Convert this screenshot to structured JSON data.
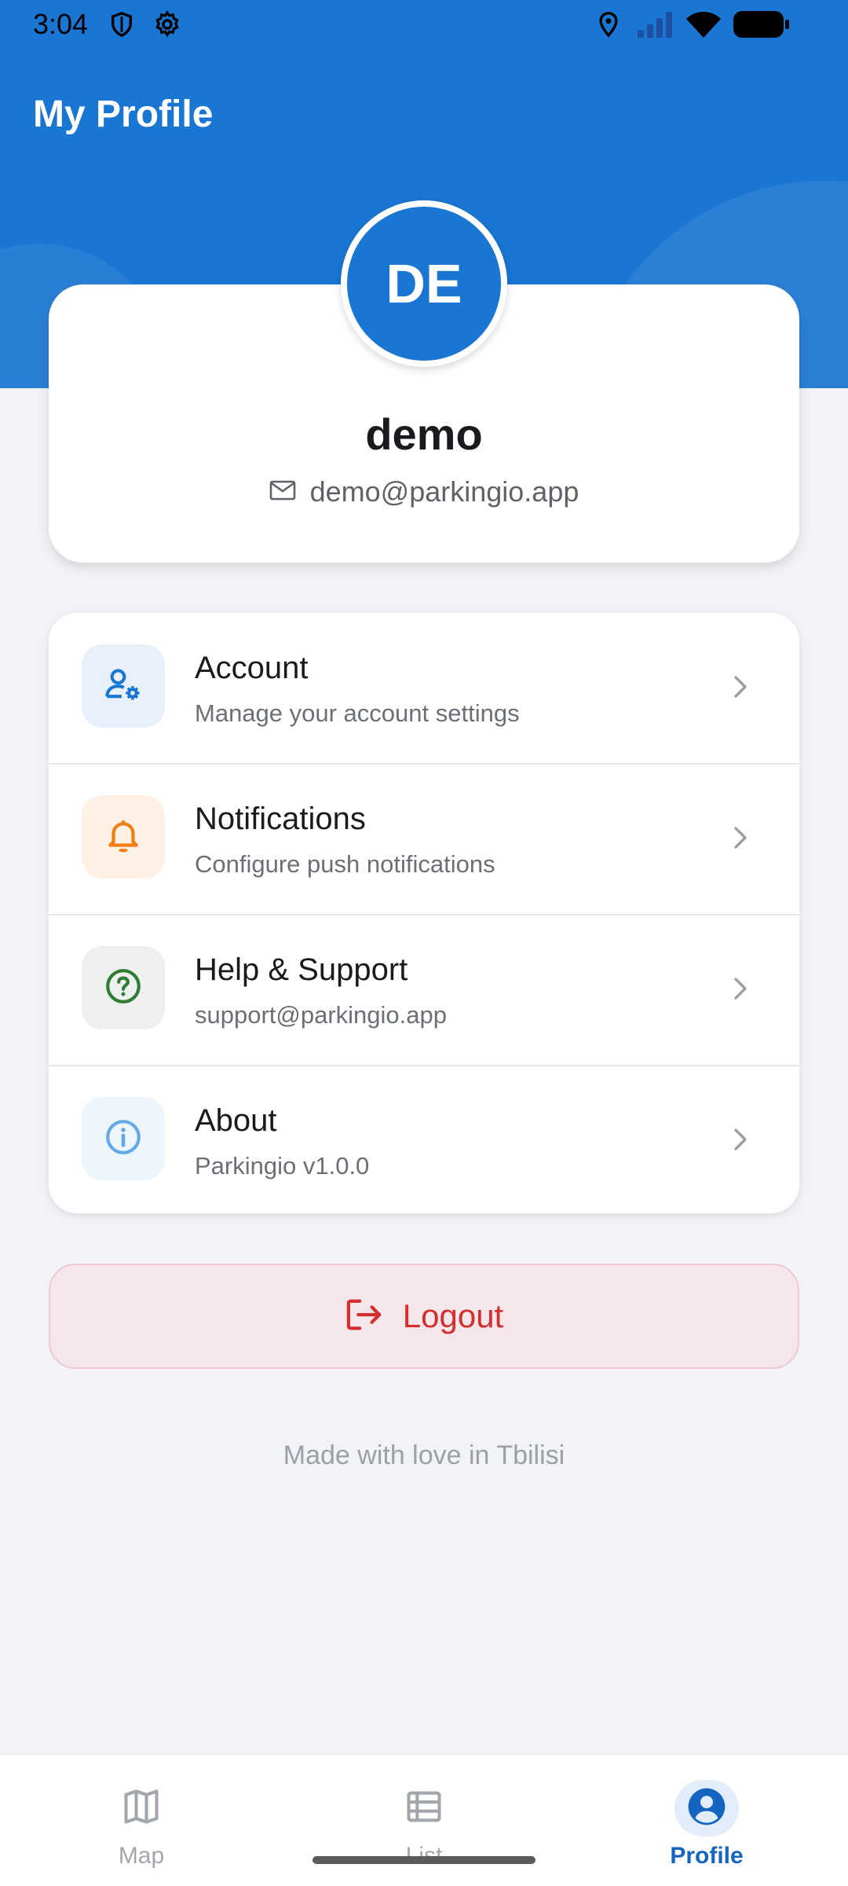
{
  "status_bar": {
    "time": "3:04",
    "left_icons": [
      "shield-icon",
      "settings-icon"
    ],
    "right_icons": [
      "location-icon",
      "cellular-signal-icon",
      "wifi-icon",
      "battery-icon"
    ]
  },
  "header": {
    "title": "My Profile",
    "accent_color": "#1976d2"
  },
  "profile": {
    "initials": "DE",
    "name": "demo",
    "email": "demo@parkingio.app"
  },
  "menu": {
    "items": [
      {
        "title": "Account",
        "subtitle": "Manage your account settings",
        "icon": "account-settings-icon",
        "icon_color": "#1976d2",
        "bg_color": "#e8f1fb"
      },
      {
        "title": "Notifications",
        "subtitle": "Configure push notifications",
        "icon": "bell-icon",
        "icon_color": "#ef7d12",
        "bg_color": "#fff1e4"
      },
      {
        "title": "Help & Support",
        "subtitle": "support@parkingio.app",
        "icon": "help-circle-icon",
        "icon_color": "#2e7d32",
        "bg_color": "#eeefef"
      },
      {
        "title": "About",
        "subtitle": "Parkingio v1.0.0",
        "icon": "info-icon",
        "icon_color": "#64a9e6",
        "bg_color": "#eef6fd"
      }
    ]
  },
  "logout": {
    "label": "Logout",
    "color": "#d32f2f"
  },
  "footer": {
    "text": "Made with love in Tbilisi"
  },
  "bottom_nav": {
    "items": [
      {
        "label": "Map",
        "icon": "map-icon",
        "active": false
      },
      {
        "label": "List",
        "icon": "list-icon",
        "active": false
      },
      {
        "label": "Profile",
        "icon": "profile-icon",
        "active": true
      }
    ]
  }
}
